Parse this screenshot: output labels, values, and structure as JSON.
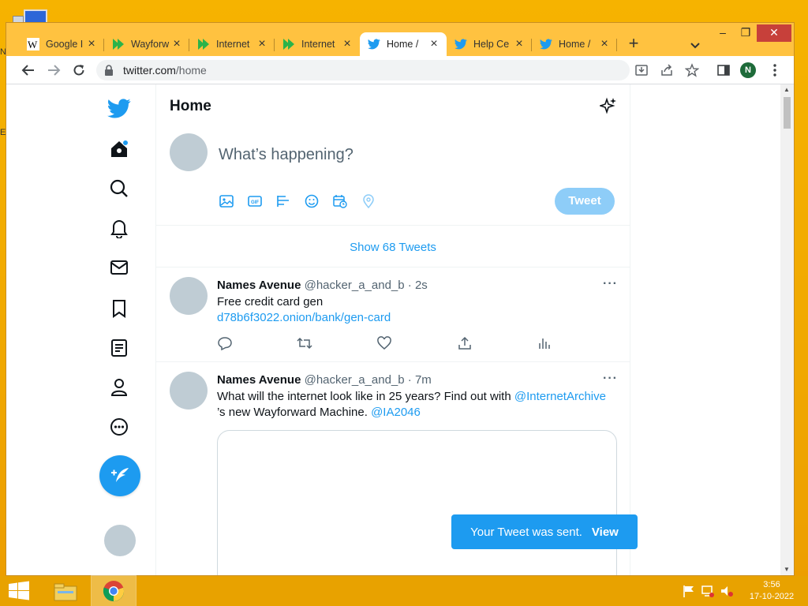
{
  "desktop": {
    "left_edge_marks": [
      "Ne",
      "E"
    ]
  },
  "browser": {
    "tabs": [
      {
        "title": "Google I",
        "favicon": "wikipedia-icon",
        "active": false
      },
      {
        "title": "Wayforw",
        "favicon": "wayforward-icon",
        "active": false
      },
      {
        "title": "Internet",
        "favicon": "wayforward-icon",
        "active": false
      },
      {
        "title": "Internet",
        "favicon": "wayforward-icon",
        "active": false
      },
      {
        "title": "Home /",
        "favicon": "twitter-bird-icon",
        "active": true
      },
      {
        "title": "Help Ce",
        "favicon": "twitter-bird-icon",
        "active": false
      },
      {
        "title": "Home /",
        "favicon": "twitter-bird-icon",
        "active": false
      }
    ],
    "url_host": "twitter.com",
    "url_path": "/home",
    "profile_initial": "N"
  },
  "twitter": {
    "page_title": "Home",
    "composer_placeholder": "What’s happening?",
    "tweet_button": "Tweet",
    "show_tweets": "Show 68 Tweets",
    "tweets": [
      {
        "name": "Names Avenue",
        "handle": "@hacker_a_and_b",
        "time": "· 2s",
        "text": "Free credit card gen",
        "link": "d78b6f3022.onion/bank/gen-card"
      },
      {
        "name": "Names Avenue",
        "handle": "@hacker_a_and_b",
        "time": "· 7m",
        "text_before": "What will the internet look like in 25 years? Find out with ",
        "mention1": "@InternetArchive",
        "text_after": "’s new Wayforward Machine. ",
        "mention2": "@IA2046"
      }
    ],
    "toast": {
      "message": "Your Tweet was sent.",
      "action": "View"
    }
  },
  "taskbar": {
    "time": "3:56",
    "date": "17-10-2022"
  },
  "colors": {
    "twitter_blue": "#1d9bf0",
    "tweet_button_disabled": "#8ecdf8",
    "desktop_orange": "#f6b300"
  }
}
